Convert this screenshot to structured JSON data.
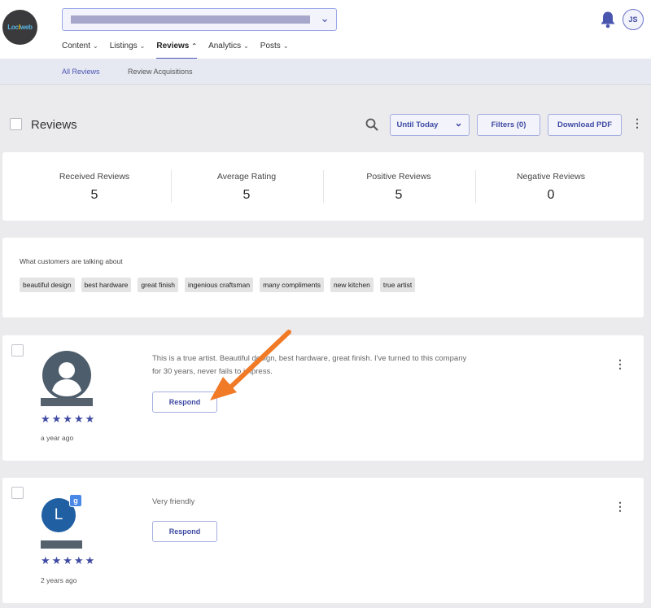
{
  "header": {
    "logo_text_a": "Loc",
    "logo_text_b": "l",
    "logo_text_c": "web",
    "avatar_initials": "JS"
  },
  "main_nav": {
    "items": [
      {
        "label": "Content",
        "caret": "⌄"
      },
      {
        "label": "Listings",
        "caret": "⌄"
      },
      {
        "label": "Reviews",
        "caret": "⌃"
      },
      {
        "label": "Analytics",
        "caret": "⌄"
      },
      {
        "label": "Posts",
        "caret": "⌄"
      }
    ],
    "active": "Reviews"
  },
  "sub_nav": {
    "items": [
      {
        "label": "All Reviews"
      },
      {
        "label": "Review Acquisitions"
      }
    ],
    "active": "All Reviews"
  },
  "toolbar": {
    "title": "Reviews",
    "date_range": "Until Today",
    "filters_label": "Filters (0)",
    "download_label": "Download PDF"
  },
  "stats": [
    {
      "label": "Received Reviews",
      "value": "5"
    },
    {
      "label": "Average Rating",
      "value": "5"
    },
    {
      "label": "Positive Reviews",
      "value": "5"
    },
    {
      "label": "Negative Reviews",
      "value": "0"
    }
  ],
  "topics": {
    "title": "What customers are talking about",
    "tags": [
      "beautiful design",
      "best hardware",
      "great finish",
      "ingenious craftsman",
      "many compliments",
      "new kitchen",
      "true artist"
    ]
  },
  "reviews": [
    {
      "text": "This is a true artist. Beautiful design, best hardware, great finish. I've turned to this company for 30 years, never fails to impress.",
      "rating": 5,
      "stars": "★★★★★",
      "time": "a year ago",
      "respond_label": "Respond"
    },
    {
      "avatar_letter": "L",
      "source_badge": "g",
      "text": "Very friendly",
      "rating": 5,
      "stars": "★★★★★",
      "time": "2 years ago",
      "respond_label": "Respond"
    }
  ],
  "colors": {
    "accent": "#4a55b0",
    "star": "#3f4aa3",
    "annotation_arrow": "#f07a26",
    "letter_avatar": "#1f5fa2"
  }
}
